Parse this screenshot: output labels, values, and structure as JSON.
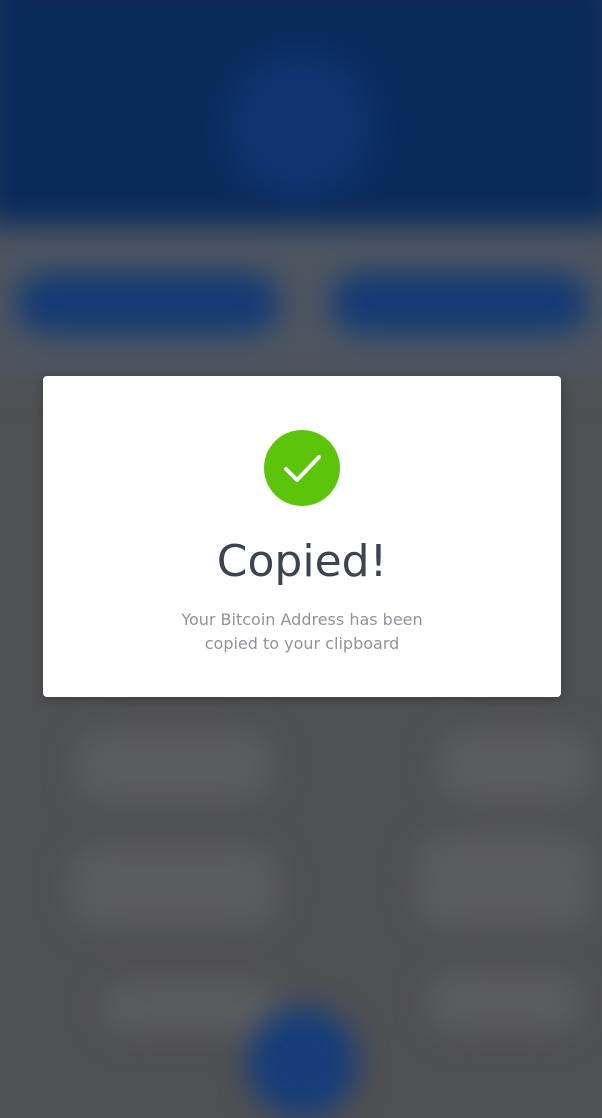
{
  "modal": {
    "icon": "checkmark-icon",
    "title": "Copied!",
    "message_line1": "Your Bitcoin Address has been",
    "message_line2": "copied to your clipboard"
  },
  "colors": {
    "success": "#5cc40a",
    "header_background": "#0a2a5c",
    "overlay": "#4f5052",
    "title_text": "#3b4451",
    "message_text": "#8e949c"
  }
}
